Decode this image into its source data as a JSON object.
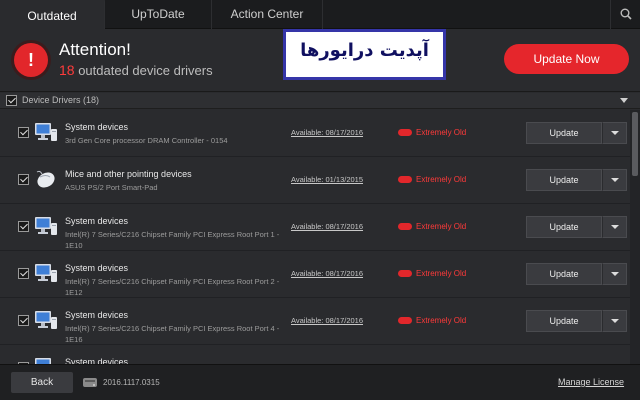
{
  "tabs": [
    {
      "label": "Outdated"
    },
    {
      "label": "UpToDate"
    },
    {
      "label": "Action Center"
    }
  ],
  "header": {
    "title": "Attention!",
    "count": "18",
    "subtitle": "outdated device drivers",
    "update_now_label": "Update Now",
    "alert_glyph": "!"
  },
  "overlay": {
    "text": "آپدیت درایورها"
  },
  "section": {
    "label": "Device Drivers (18)"
  },
  "rows": [
    {
      "title": "System devices",
      "desc": "3rd Gen Core processor DRAM Controller - 0154",
      "available": "Available: 08/17/2016",
      "status": "Extremely Old",
      "update_label": "Update",
      "icon": "monitor-icon"
    },
    {
      "title": "Mice and other pointing devices",
      "desc": "ASUS PS/2 Port Smart-Pad",
      "available": "Available: 01/13/2015",
      "status": "Extremely Old",
      "update_label": "Update",
      "icon": "mouse-icon"
    },
    {
      "title": "System devices",
      "desc": "Intel(R) 7 Series/C216 Chipset Family PCI Express Root Port 1 - 1E10",
      "available": "Available: 08/17/2016",
      "status": "Extremely Old",
      "update_label": "Update",
      "icon": "monitor-icon"
    },
    {
      "title": "System devices",
      "desc": "Intel(R) 7 Series/C216 Chipset Family PCI Express Root Port 2 - 1E12",
      "available": "Available: 08/17/2016",
      "status": "Extremely Old",
      "update_label": "Update",
      "icon": "monitor-icon"
    },
    {
      "title": "System devices",
      "desc": "Intel(R) 7 Series/C216 Chipset Family PCI Express Root Port 4 - 1E16",
      "available": "Available: 08/17/2016",
      "status": "Extremely Old",
      "update_label": "Update",
      "icon": "monitor-icon"
    },
    {
      "title": "System devices",
      "desc": "",
      "available": "",
      "status": "",
      "update_label": "",
      "icon": "monitor-icon"
    }
  ],
  "footer": {
    "back_label": "Back",
    "version": "2016.1117.0315",
    "manage_label": "Manage License"
  },
  "colors": {
    "accent": "#e5262c",
    "background": "#2a2b2e",
    "status_red": "#ff3a3a"
  }
}
